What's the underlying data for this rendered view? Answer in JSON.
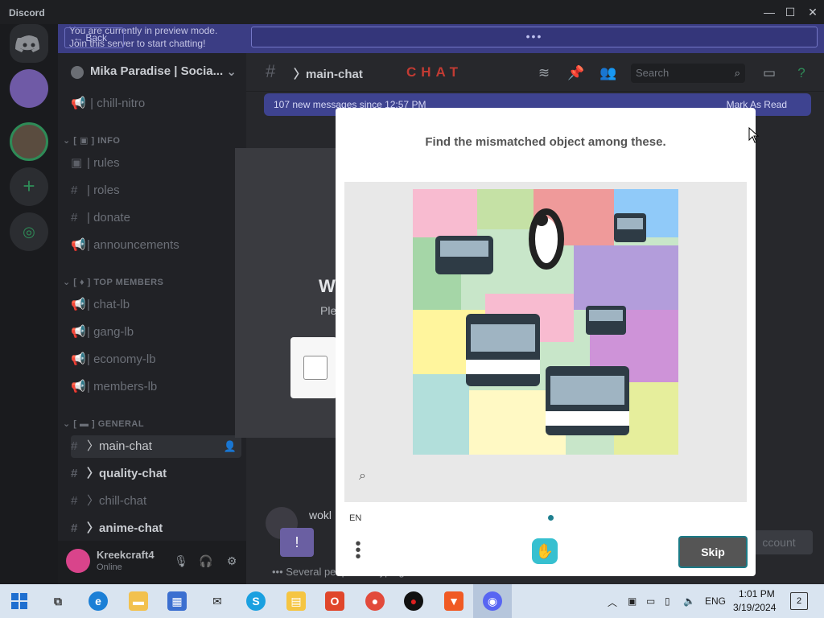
{
  "window": {
    "title": "Discord",
    "controls": {
      "minimize": "—",
      "maximize": "☐",
      "close": "✕"
    }
  },
  "preview_banner": {
    "back_label": "Back",
    "line1": "You are currently in preview mode.",
    "line2": "Join this server to start chatting!",
    "field_value": "•••"
  },
  "server": {
    "name": "Mika Paradise | Socia...",
    "chevron": "⌄"
  },
  "sidebar": {
    "channels_top": [
      {
        "glyph": "📢",
        "label": "| chill-nitro"
      }
    ],
    "categories": [
      {
        "label": "INFO",
        "channels": [
          {
            "glyph": "▣",
            "label": "| rules"
          },
          {
            "glyph": "#",
            "label": "| roles"
          },
          {
            "glyph": "#",
            "label": "| donate"
          },
          {
            "glyph": "📢",
            "label": "| announcements"
          }
        ]
      },
      {
        "label": "TOP MEMBERS",
        "channels": [
          {
            "glyph": "📢",
            "label": "| chat-lb"
          },
          {
            "glyph": "📢",
            "label": "| gang-lb"
          },
          {
            "glyph": "📢",
            "label": "| economy-lb"
          },
          {
            "glyph": "📢",
            "label": "| members-lb"
          }
        ]
      },
      {
        "label": "GENERAL",
        "channels": [
          {
            "glyph": "#",
            "label": "〉main-chat"
          },
          {
            "glyph": "#",
            "label": "〉quality-chat"
          },
          {
            "glyph": "#",
            "label": "〉chill-chat"
          },
          {
            "glyph": "#",
            "label": "〉anime-chat"
          }
        ]
      }
    ]
  },
  "user": {
    "name": "Kreekcraft4",
    "status": "Online"
  },
  "chat": {
    "hash": "#",
    "title": "〉main-chat",
    "deco": "CHAT",
    "search_placeholder": "Search",
    "new_messages": "107 new messages since 12:57 PM",
    "mark_as_read": "Mark As Read",
    "dim_heading": "W",
    "dim_sub": "Ple",
    "msg_author": "wokl",
    "typing": "Several people are typing...",
    "account_btn": "ccount"
  },
  "captcha": {
    "prompt": "Find the mismatched object among these.",
    "lang": "EN",
    "skip_label": "Skip",
    "image_subject": "buses-and-penguin"
  },
  "taskbar": {
    "lang": "ENG",
    "time": "1:01 PM",
    "date": "3/19/2024",
    "notifications": "2"
  }
}
